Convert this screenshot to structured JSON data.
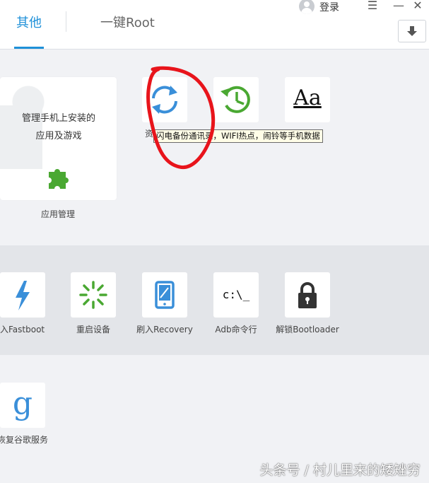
{
  "header": {
    "tabs": [
      {
        "label": "其他"
      },
      {
        "label": "一键Root"
      }
    ],
    "login_label": "登录",
    "menu_glyph": "☰",
    "minimize_glyph": "—",
    "close_glyph": "✕"
  },
  "app_management": {
    "line1": "管理手机上安装的",
    "line2": "应用及游戏",
    "label": "应用管理"
  },
  "row1_tiles": [
    {
      "icon": "sync-icon",
      "label": "资"
    },
    {
      "icon": "history-clock-icon",
      "label": ""
    },
    {
      "icon": "font-icon",
      "glyph": "Aa",
      "label": ""
    }
  ],
  "tooltip": "闪电备份通讯录，WIFI热点，闹铃等手机数据",
  "row2_tiles": [
    {
      "icon": "fastboot-lightning-icon",
      "label": "进入Fastboot"
    },
    {
      "icon": "restart-spinner-icon",
      "label": "重启设备"
    },
    {
      "icon": "recovery-tablet-icon",
      "label": "刷入Recovery"
    },
    {
      "icon": "terminal-icon",
      "glyph": "c:\\_",
      "label": "Adb命令行"
    },
    {
      "icon": "padlock-icon",
      "label": "解锁Bootloader"
    }
  ],
  "row3_tiles": [
    {
      "icon": "google-g-icon",
      "glyph": "g",
      "label": "恢复谷歌服务"
    }
  ],
  "watermark": "头条号 / 村儿里来的矮矬穷",
  "colors": {
    "accent": "#1e90d8",
    "green": "#4aa832",
    "annotation_red": "#e8141b"
  }
}
